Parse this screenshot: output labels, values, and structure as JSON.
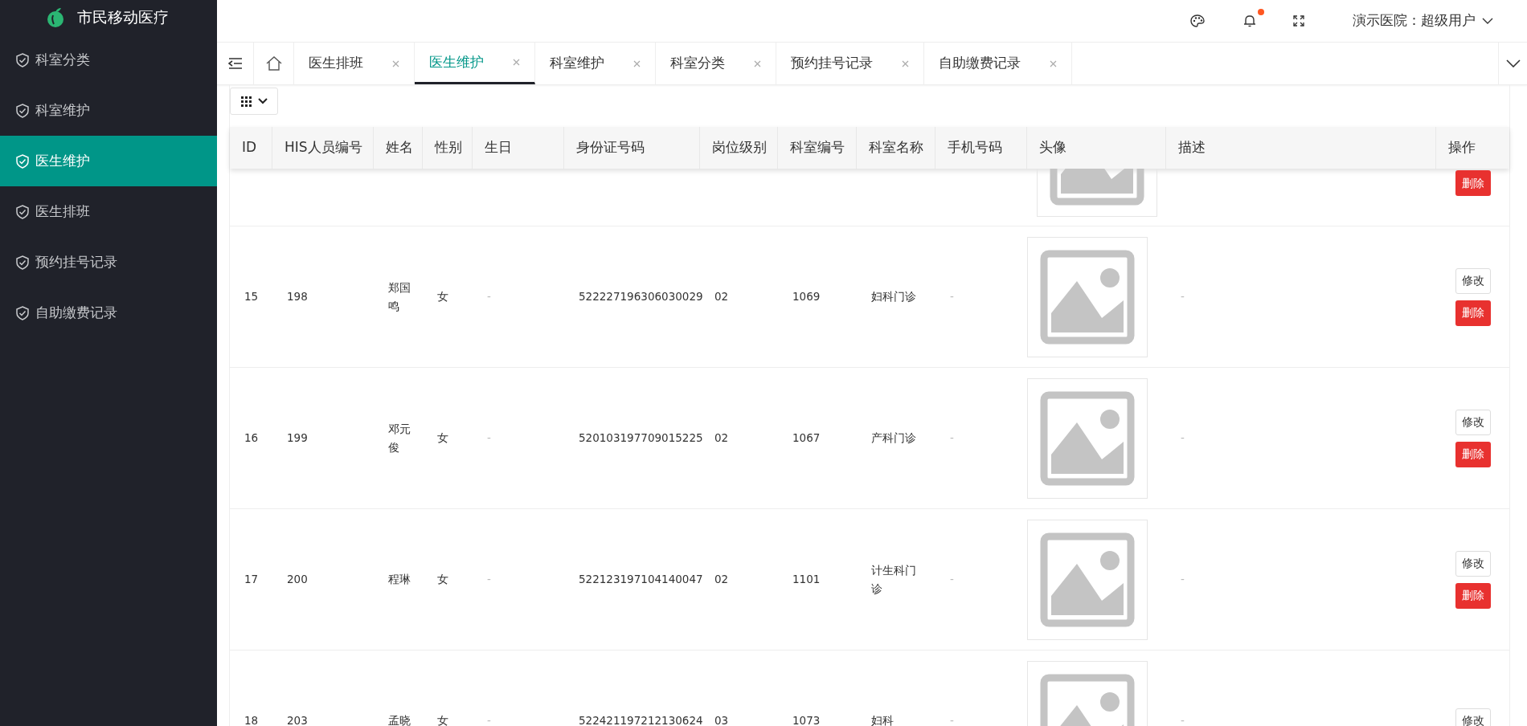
{
  "app": {
    "title": "市民移动医疗"
  },
  "sidebar": {
    "items": [
      {
        "label": "科室分类",
        "selected": false
      },
      {
        "label": "科室维护",
        "selected": false
      },
      {
        "label": "医生维护",
        "selected": true
      },
      {
        "label": "医生排班",
        "selected": false
      },
      {
        "label": "预约挂号记录",
        "selected": false
      },
      {
        "label": "自助缴费记录",
        "selected": false
      }
    ]
  },
  "header": {
    "user": "演示医院：超级用户",
    "notification_dot": true
  },
  "tabs": [
    {
      "label": "医生排班",
      "selected": false
    },
    {
      "label": "医生维护",
      "selected": true
    },
    {
      "label": "科室维护",
      "selected": false
    },
    {
      "label": "科室分类",
      "selected": false
    },
    {
      "label": "预约挂号记录",
      "selected": false
    },
    {
      "label": "自助缴费记录",
      "selected": false
    }
  ],
  "table": {
    "columns": [
      "ID",
      "HIS人员编号",
      "姓名",
      "性别",
      "生日",
      "身份证号码",
      "岗位级别",
      "科室编号",
      "科室名称",
      "手机号码",
      "头像",
      "描述",
      "操作"
    ],
    "rows": [
      {
        "kind": "clipped",
        "actions": [
          {
            "kind": "delete",
            "label": "删除"
          }
        ]
      },
      {
        "kind": "full",
        "cells": [
          "15",
          "198",
          "郑国鸣",
          "女",
          "-",
          "522227196306030029",
          "02",
          "1069",
          "妇科门诊",
          "-"
        ],
        "description": "-",
        "actions": [
          {
            "kind": "edit",
            "label": "修改"
          },
          {
            "kind": "delete",
            "label": "删除"
          }
        ]
      },
      {
        "kind": "full",
        "cells": [
          "16",
          "199",
          "邓元俊",
          "女",
          "-",
          "520103197709015225",
          "02",
          "1067",
          "产科门诊",
          "-"
        ],
        "description": "-",
        "actions": [
          {
            "kind": "edit",
            "label": "修改"
          },
          {
            "kind": "delete",
            "label": "删除"
          }
        ]
      },
      {
        "kind": "full",
        "cells": [
          "17",
          "200",
          "程琳",
          "女",
          "-",
          "522123197104140047",
          "02",
          "1101",
          "计生科门诊",
          "-"
        ],
        "description": "-",
        "actions": [
          {
            "kind": "edit",
            "label": "修改"
          },
          {
            "kind": "delete",
            "label": "删除"
          }
        ]
      },
      {
        "kind": "full",
        "cells": [
          "18",
          "203",
          "孟晓",
          "女",
          "-",
          "522421197212130624",
          "03",
          "1073",
          "妇科",
          "-"
        ],
        "description": "-",
        "actions": [
          {
            "kind": "edit",
            "label": "修改"
          }
        ]
      }
    ]
  }
}
